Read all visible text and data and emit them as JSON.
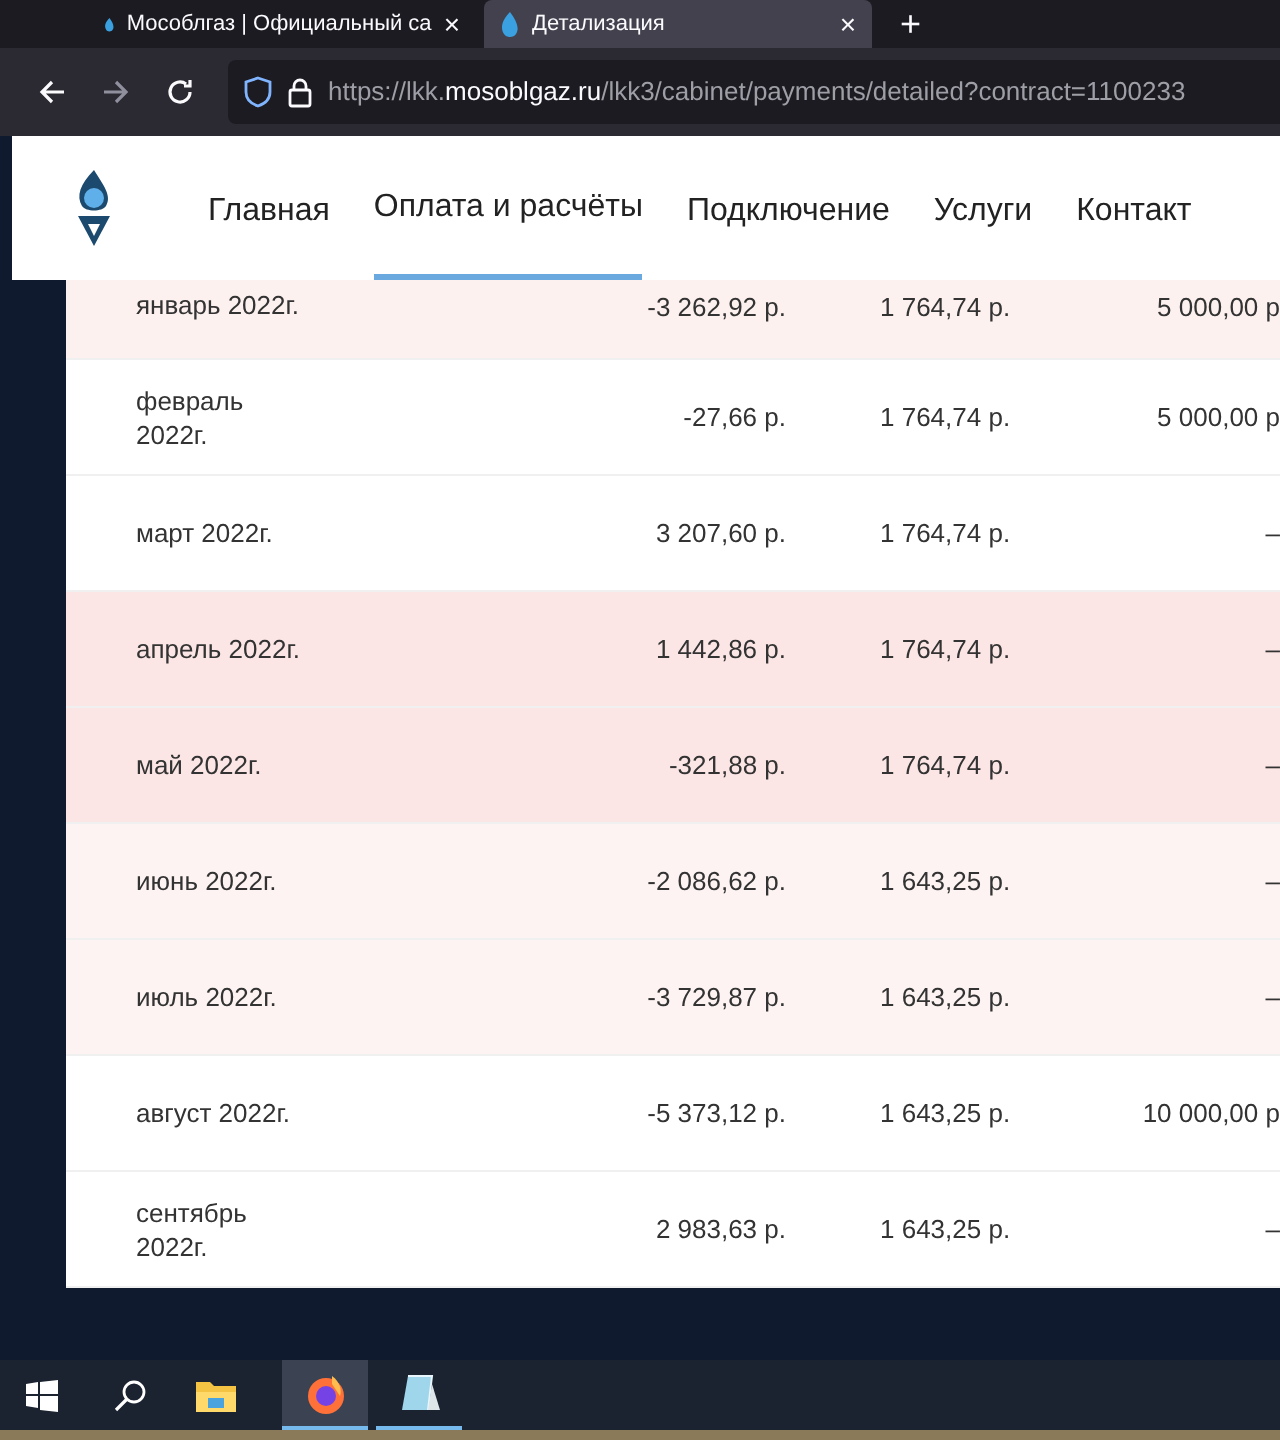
{
  "browser": {
    "tabs": [
      {
        "title": "Мособлгаз | Официальный са",
        "selected": false,
        "close": "×"
      },
      {
        "title": "Детализация",
        "selected": true,
        "close": "×"
      }
    ],
    "new_tab": "+",
    "url": {
      "prefix": "https://lkk.",
      "domain": "mosoblgaz.ru",
      "path": "/lkk3/cabinet/payments/detailed?contract=1100233"
    }
  },
  "nav": [
    {
      "label": "Главная",
      "selected": false
    },
    {
      "label": "Оплата и расчёты",
      "selected": true
    },
    {
      "label": "Подключение",
      "selected": false
    },
    {
      "label": "Услуги",
      "selected": false
    },
    {
      "label": "Контакт",
      "selected": false
    }
  ],
  "table": {
    "rows": [
      {
        "month": "январь 2022г.",
        "balance": "-3 262,92 р.",
        "charged": "1 764,74 р.",
        "paid": "5 000,00 р",
        "color": "#fdf1ef"
      },
      {
        "month": "февраль 2022г.",
        "balance": "-27,66 р.",
        "charged": "1 764,74 р.",
        "paid": "5 000,00 р",
        "color": "#ffffff"
      },
      {
        "month": "март 2022г.",
        "balance": "3 207,60 р.",
        "charged": "1 764,74 р.",
        "paid": "–",
        "color": "#ffffff"
      },
      {
        "month": "апрель 2022г.",
        "balance": "1 442,86 р.",
        "charged": "1 764,74 р.",
        "paid": "–",
        "color": "#fce6e5"
      },
      {
        "month": "май 2022г.",
        "balance": "-321,88 р.",
        "charged": "1 764,74 р.",
        "paid": "–",
        "color": "#fce6e5"
      },
      {
        "month": "июнь 2022г.",
        "balance": "-2 086,62 р.",
        "charged": "1 643,25 р.",
        "paid": "–",
        "color": "#fdf3f2"
      },
      {
        "month": "июль 2022г.",
        "balance": "-3 729,87 р.",
        "charged": "1 643,25 р.",
        "paid": "–",
        "color": "#fdf3f2"
      },
      {
        "month": "август 2022г.",
        "balance": "-5 373,12 р.",
        "charged": "1 643,25 р.",
        "paid": "10 000,00 р",
        "color": "#ffffff"
      },
      {
        "month": "сентябрь 2022г.",
        "balance": "2 983,63 р.",
        "charged": "1 643,25 р.",
        "paid": "–",
        "color": "#ffffff"
      }
    ]
  }
}
